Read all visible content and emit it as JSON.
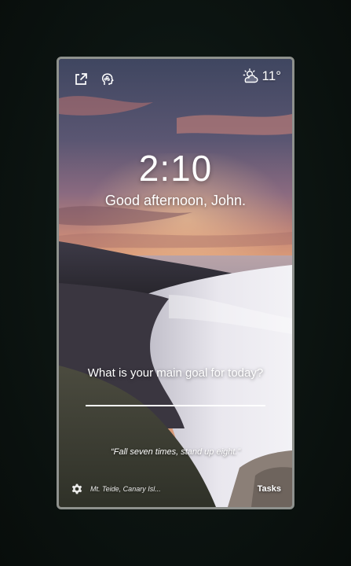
{
  "header": {
    "temperature": "11°"
  },
  "clock": {
    "time": "2:10"
  },
  "greeting": "Good afternoon, John.",
  "focus": {
    "question": "What is your main goal for today?",
    "input_value": ""
  },
  "quote": "“Fall seven times, stand up eight.”",
  "footer": {
    "location": "Mt. Teide, Canary Isl...",
    "tasks_label": "Tasks"
  },
  "colors": {
    "text": "#ffffff",
    "frame_border": "#8e918d",
    "page_background": "#0b1310"
  }
}
